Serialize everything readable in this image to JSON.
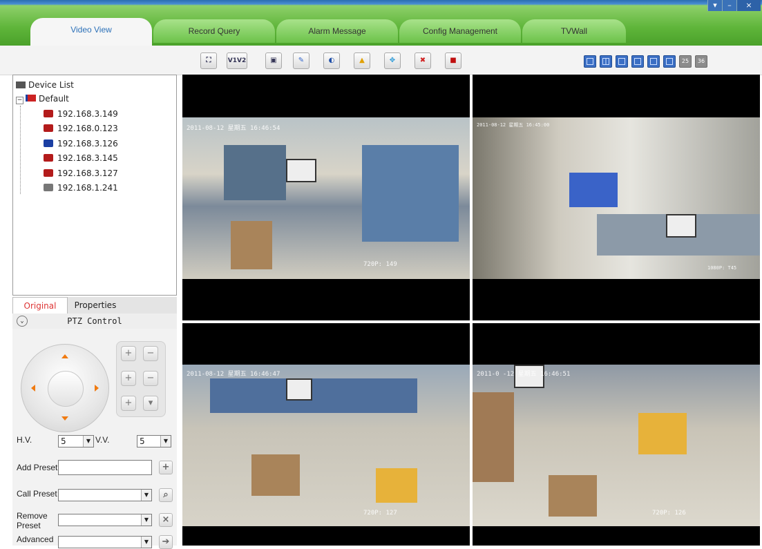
{
  "window_controls": [
    "▾",
    "–",
    "×"
  ],
  "tabs": [
    "Video View",
    "Record Query",
    "Alarm Message",
    "Config Management",
    "TVWall"
  ],
  "active_tab": "Video View",
  "toolbar": {
    "icons": [
      "fullscreen-icon",
      "v1v2-icon",
      "snapshot-icon",
      "brush-icon",
      "audio-icon",
      "alarm-bell-icon",
      "ptz-direction-icon",
      "stop-icon",
      "record-icon"
    ],
    "v1v2_label": "V1V2",
    "layout_icons": [
      "layout-1-icon",
      "layout-4-icon",
      "layout-6-icon",
      "layout-8-icon",
      "layout-9-icon",
      "layout-16-icon",
      "layout-25-icon",
      "layout-36-icon"
    ],
    "layout_25_label": "25",
    "layout_36_label": "36"
  },
  "device_tree": {
    "root": "Device List",
    "group": "Default",
    "devices": [
      {
        "ip": "192.168.3.149",
        "status": "red"
      },
      {
        "ip": "192.168.0.123",
        "status": "red"
      },
      {
        "ip": "192.168.3.126",
        "status": "blue"
      },
      {
        "ip": "192.168.3.145",
        "status": "red"
      },
      {
        "ip": "192.168.3.127",
        "status": "red"
      },
      {
        "ip": "192.168.1.241",
        "status": "grey"
      }
    ]
  },
  "panel_tabs": [
    "Original",
    "Properties"
  ],
  "ptz": {
    "title": "PTZ Control",
    "hv_label": "H.V.",
    "hv_value": "5",
    "vv_label": "V.V.",
    "vv_value": "5",
    "add_preset_label": "Add Preset",
    "call_preset_label": "Call Preset",
    "remove_preset_label": "Remove Preset",
    "advanced_label": "Advanced"
  },
  "videos": [
    {
      "timestamp": "2011-08-12 星期五 16:46:54",
      "caption": "720P: 149"
    },
    {
      "timestamp": "2011-08-12 星期五 16:45:00",
      "caption": "1080P: T45"
    },
    {
      "timestamp": "2011-08-12 星期五 16:46:47",
      "caption": "720P: 127"
    },
    {
      "timestamp": "2011-0  -12 星期五 16:46:51",
      "caption": "720P: 126"
    }
  ]
}
